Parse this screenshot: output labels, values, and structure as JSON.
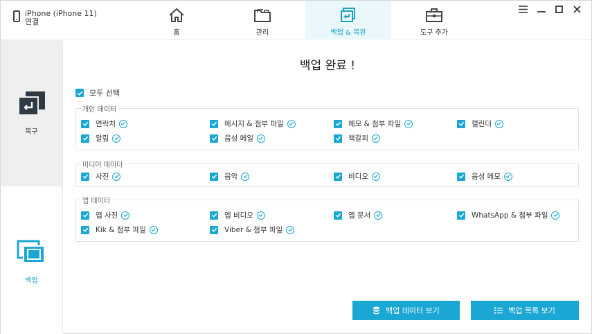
{
  "device": {
    "name": "iPhone (iPhone 11)",
    "status": "연결"
  },
  "nav": [
    {
      "label": "홈",
      "icon": "home-icon"
    },
    {
      "label": "관리",
      "icon": "folder-icon"
    },
    {
      "label": "백업 & 복원",
      "icon": "backup-restore-icon",
      "active": true
    },
    {
      "label": "도구 추가",
      "icon": "toolbox-icon"
    }
  ],
  "sidebar": {
    "restore_label": "복구",
    "backup_label": "백업"
  },
  "main": {
    "title": "백업 완료 !",
    "select_all": "모두 선택",
    "groups": [
      {
        "title": "개인 데이터",
        "items": [
          "연락처",
          "메시지 & 첨부 파일",
          "메모 & 첨부 파일",
          "캘린더",
          "알림",
          "음성 메일",
          "책갈피"
        ]
      },
      {
        "title": "미디어 데이터",
        "items": [
          "사진",
          "음악",
          "비디오",
          "음성 메모"
        ]
      },
      {
        "title": "앱 데이터",
        "items": [
          "앱 사진",
          "앱 비디오",
          "앱 문서",
          "WhatsApp & 첨부 파일",
          "Kik & 첨부 파일",
          "Viber & 첨부 파일"
        ]
      }
    ],
    "buttons": {
      "view_data": "백업 데이터 보기",
      "view_list": "백업 목록 보기"
    }
  },
  "colors": {
    "accent": "#1aa7d4",
    "active_tab_bg": "#eaf7fb",
    "sidebar_active_bg": "#efefef"
  }
}
